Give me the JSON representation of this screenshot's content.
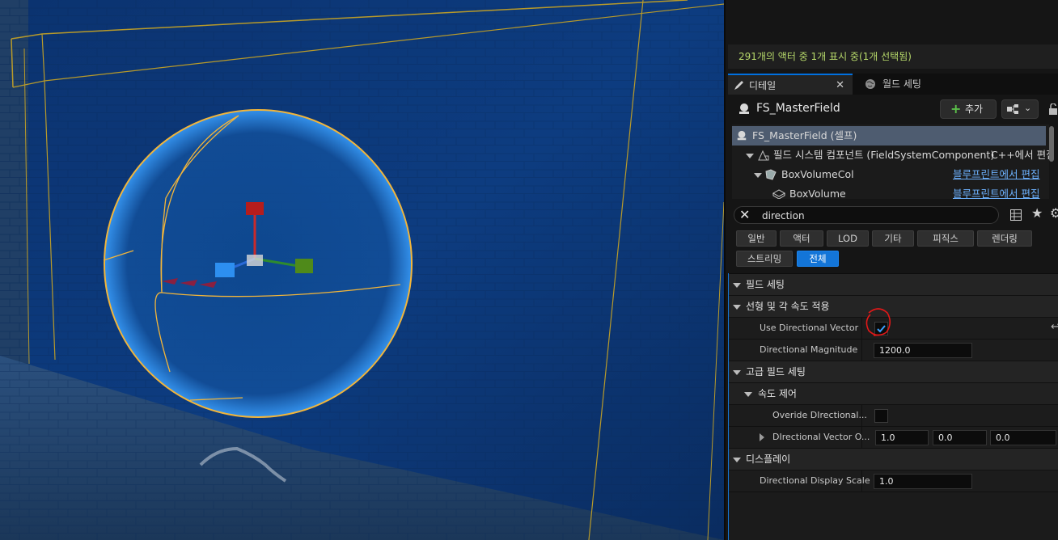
{
  "viewport": {
    "scene": "level-viewport"
  },
  "details": {
    "status_text": "291개의 액터 중 1개 표시 중(1개 선택됨)",
    "tabs": [
      {
        "label": "디테일",
        "icon": "pencil-icon"
      },
      {
        "label": "월드 세팅",
        "icon": "globe-icon"
      }
    ],
    "actor_name": "FS_MasterField",
    "add_label": "추가",
    "tree": [
      {
        "label": "FS_MasterField (셀프)"
      },
      {
        "label": "필드 시스템 컴포넌트 (FieldSystemComponent)",
        "link": "C++에서 편집"
      },
      {
        "label": "BoxVolumeCol",
        "link": "블루프린트에서 편집"
      },
      {
        "label": "BoxVolume",
        "link": "블루프린트에서 편집"
      }
    ],
    "search_value": "direction",
    "filters": [
      "일반",
      "액터",
      "LOD",
      "기타",
      "피직스",
      "렌더링",
      "스트리밍",
      "전체"
    ],
    "sections": {
      "field_settings": "필드 세팅",
      "linear_angular": "선형 및 각 속도 적용",
      "advanced": "고급 필드 세팅",
      "velocity": "속도 제어",
      "display": "디스플레이"
    },
    "props": {
      "use_directional_vector": {
        "label": "Use Directional Vector",
        "checked": true
      },
      "directional_magnitude": {
        "label": "Directional Magnitude",
        "value": "1200.0"
      },
      "override_directional": {
        "label": "Overide DIrectional...",
        "checked": false
      },
      "directional_vector_override": {
        "label": "DIrectional Vector O...",
        "x": "1.0",
        "y": "0.0",
        "z": "0.0"
      },
      "directional_display_scale": {
        "label": "Directional Display Scale",
        "value": "1.0"
      }
    },
    "accent": "#1476d6"
  }
}
